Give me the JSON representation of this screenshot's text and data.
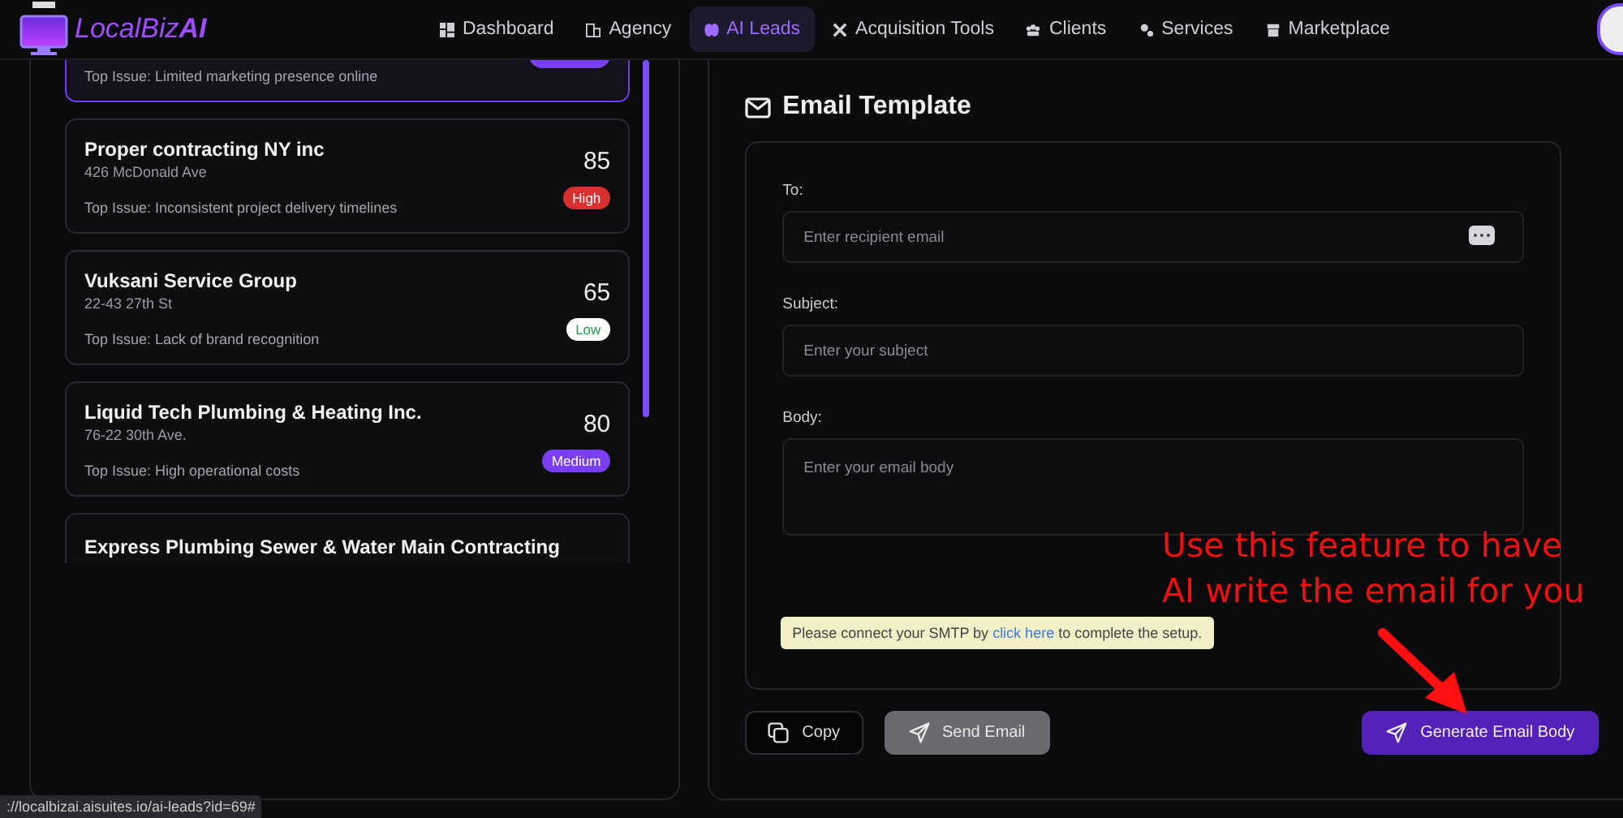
{
  "nav": {
    "brand": "LocalBiz**AI**",
    "items": [
      {
        "label": "Dashboard",
        "selected": false
      },
      {
        "label": "Agency",
        "selected": false
      },
      {
        "label": "AI Leads",
        "selected": true
      },
      {
        "label": "Acquisition Tools",
        "selected": false
      },
      {
        "label": "Clients",
        "selected": false
      },
      {
        "label": "Services",
        "selected": false
      },
      {
        "label": "Marketplace",
        "selected": false
      }
    ]
  },
  "leads": [
    {
      "kind": "partial",
      "issue": "Top Issue: Limited marketing presence online",
      "color": "#7b3ff2",
      "selected": true
    },
    {
      "kind": "full",
      "name": "Proper contracting NY inc",
      "address": "426 McDonald Ave",
      "issue": "Top Issue: Inconsistent project delivery timelines",
      "score": "85",
      "priority": "High",
      "color": "#d93030",
      "selected": false
    },
    {
      "kind": "full",
      "name": "Vuksani Service Group",
      "address": "22-43 27th St",
      "issue": "Top Issue: Lack of brand recognition",
      "score": "65",
      "priority": "Low",
      "color": "#ffffff",
      "selected": false
    },
    {
      "kind": "full",
      "name": "Liquid Tech Plumbing & Heating Inc.",
      "address": "76-22 30th Ave.",
      "issue": "Top Issue: High operational costs",
      "score": "80",
      "priority": "Medium",
      "color": "#7b3ff2",
      "selected": false
    },
    {
      "kind": "cut",
      "name": "Express Plumbing Sewer & Water Main Contracting",
      "selected": false
    }
  ],
  "email": {
    "title": "Email Template",
    "fields": [
      {
        "label": "To:",
        "placeholder": "Enter recipient email",
        "kind": "input_action"
      },
      {
        "label": "Subject:",
        "placeholder": "Enter your subject",
        "kind": "input"
      },
      {
        "label": "Body:",
        "placeholder": "Enter your email body",
        "kind": "textarea"
      }
    ],
    "notice": {
      "before": "Please connect your SMTP by ",
      "link": "click here",
      "after": " to complete the setup."
    },
    "buttons": [
      {
        "label": "Copy",
        "kind": "outline"
      },
      {
        "label": "Send Email",
        "kind": "send",
        "disabled": true
      },
      {
        "label": "Generate Email Body",
        "kind": "primary"
      }
    ]
  },
  "annotation": {
    "text": "Use this feature to have AI write the email for you"
  },
  "status_url": "://localbizai.aisuites.io/ai-leads?id=69#"
}
